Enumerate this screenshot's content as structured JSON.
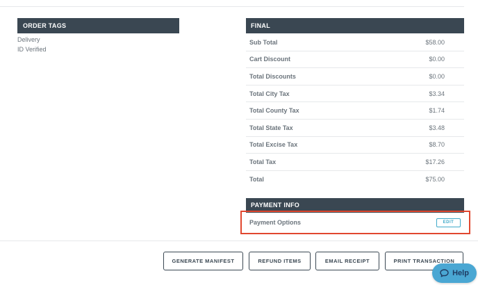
{
  "order_tags": {
    "header": "ORDER TAGS",
    "items": [
      "Delivery",
      "ID Verified"
    ]
  },
  "final": {
    "header": "FINAL",
    "rows": [
      {
        "label": "Sub Total",
        "value": "$58.00"
      },
      {
        "label": "Cart Discount",
        "value": "$0.00"
      },
      {
        "label": "Total Discounts",
        "value": "$0.00"
      },
      {
        "label": "Total City Tax",
        "value": "$3.34"
      },
      {
        "label": "Total County Tax",
        "value": "$1.74"
      },
      {
        "label": "Total State Tax",
        "value": "$3.48"
      },
      {
        "label": "Total Excise Tax",
        "value": "$8.70"
      },
      {
        "label": "Total Tax",
        "value": "$17.26"
      },
      {
        "label": "Total",
        "value": "$75.00"
      }
    ]
  },
  "payment_info": {
    "header": "PAYMENT INFO",
    "label": "Payment Options",
    "edit_label": "EDIT"
  },
  "actions": {
    "generate_manifest": "GENERATE MANIFEST",
    "refund_items": "REFUND ITEMS",
    "email_receipt": "EMAIL RECEIPT",
    "print_transaction": "PRINT TRANSACTION"
  },
  "help": {
    "label": "Help",
    "icon": "chat-bubble-icon"
  },
  "colors": {
    "header_bg": "#3a4752",
    "highlight": "#e1472f",
    "accent": "#3fa9c9",
    "help_bg": "#4aa7d3"
  }
}
